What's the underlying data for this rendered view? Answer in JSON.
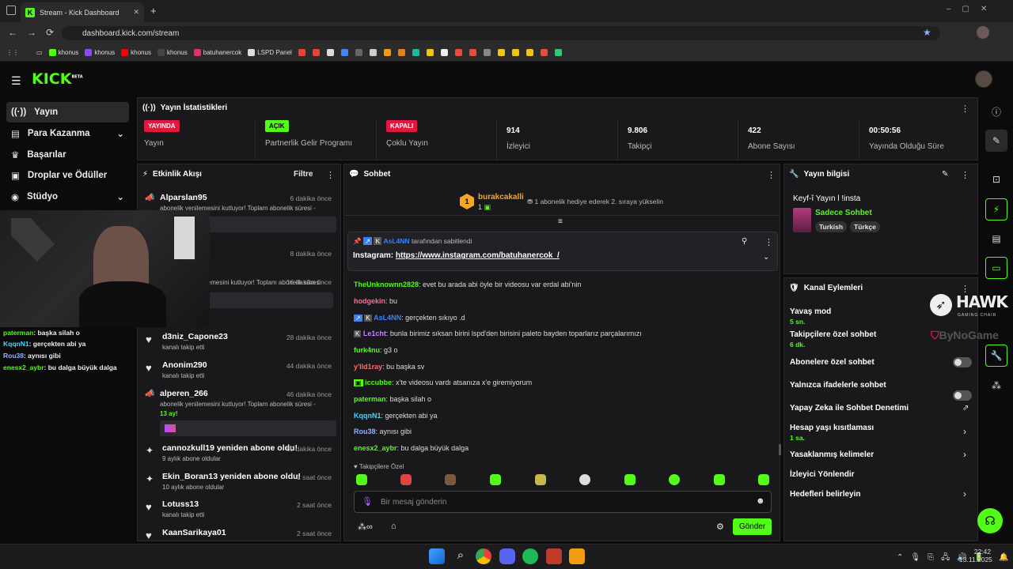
{
  "browser": {
    "tab_title": "Stream - Kick Dashboard",
    "url": "dashboard.kick.com/stream",
    "bookmarks": [
      "khonus",
      "khonus",
      "khonus",
      "khonus",
      "batuhanercok",
      "LSPD Panel"
    ]
  },
  "header": {
    "logo": "KICK",
    "beta": "BETA"
  },
  "sidebar": {
    "items": [
      {
        "label": "Yayın",
        "icon": "broadcast-icon"
      },
      {
        "label": "Para Kazanma",
        "icon": "money-icon"
      },
      {
        "label": "Başarılar",
        "icon": "trophy-icon"
      },
      {
        "label": "Droplar ve Ödüller",
        "icon": "gift-icon"
      },
      {
        "label": "Stüdyo",
        "icon": "studio-icon"
      }
    ]
  },
  "stats": {
    "title": "Yayın İstatistikleri",
    "cells": [
      {
        "badge": "YAYINDA",
        "label": "Yayın"
      },
      {
        "badge": "AÇIK",
        "label": "Partnerlik Gelir Programı"
      },
      {
        "badge": "KAPALI",
        "label": "Çoklu Yayın"
      },
      {
        "value": "914",
        "label": "İzleyici"
      },
      {
        "value": "9.806",
        "label": "Takipçi"
      },
      {
        "value": "422",
        "label": "Abone Sayısı"
      },
      {
        "value": "00:50:56",
        "label": "Yayında Olduğu Süre"
      }
    ]
  },
  "activity": {
    "title": "Etkinlik Akışı",
    "filter": "Filtre",
    "items": [
      {
        "name": "Alparslan95",
        "time": "6 dakika önce",
        "sub": "abonelik yenilemesini kutluyor! Toplam abonelik süresi -"
      },
      {
        "name": "z",
        "time": "8 dakika önce",
        "sub": ""
      },
      {
        "name": "",
        "time": "16 dakika önce",
        "sub": "lemesini kutluyor! Toplam abonelik süresi -"
      },
      {
        "name": "d3niz_Capone23",
        "time": "28 dakika önce",
        "sub": "kanalı takip etti"
      },
      {
        "name": "Anonim290",
        "time": "44 dakika önce",
        "sub": "kanalı takip etti"
      },
      {
        "name": "alperen_266",
        "time": "46 dakika önce",
        "sub": "abonelik yenilemesini kutluyor! Toplam abonelik süresi -",
        "sub2": "13 ay!"
      },
      {
        "name": "cannozkull19 yeniden abone oldu!",
        "time": "59 dakika önce",
        "sub": "9 aylık abone oldular"
      },
      {
        "name": "Ekin_Boran13 yeniden abone oldu!",
        "time": "1 saat önce",
        "sub": "10 aylık abone oldular"
      },
      {
        "name": "Lotuss13",
        "time": "2 saat önce",
        "sub": "kanalı takip etti"
      },
      {
        "name": "KaanSarikaya01",
        "time": "2 saat önce",
        "sub": ""
      }
    ]
  },
  "overlay_chat": [
    {
      "user": "paterman",
      "msg": ": başka silah o",
      "color": "#53fc18"
    },
    {
      "user": "KqqnN1",
      "msg": ": gerçekten abi ya",
      "color": "#4fd1ff"
    },
    {
      "user": "Rou38",
      "msg": ": aynısı gibi",
      "color": "#8fb3ff"
    },
    {
      "user": "enesx2_aybr",
      "msg": ": bu dalga büyük dalga",
      "color": "#53fc18"
    }
  ],
  "chat": {
    "title": "Sohbet",
    "top_user": "burakcakalli",
    "top_count": "1",
    "gift_text": "1 abonelik hediye ederek 2. sıraya yükselin",
    "pinned_by": "AsL4NN",
    "pinned_suffix": "tarafından sabitlendi",
    "pinned_prefix": "Instagram: ",
    "pinned_link": "https://www.instagram.com/batuhanercok_/",
    "messages": [
      {
        "user": "TheUnknownn2828",
        "msg": ": evet bu arada abi öyle bir videosu var erdal abi'nin",
        "color": "#53fc18"
      },
      {
        "user": "hodgekin",
        "msg": ": bu",
        "color": "#ff6b9d"
      },
      {
        "user": "AsL4NN",
        "msg": ": gerçekten sıkıyo .d",
        "color": "#3b82f6"
      },
      {
        "user": "Le1cht",
        "msg": ": bunla birimiz sıksan birini lspd'den birisini paleto bayden toparlarız parçalarımızı",
        "color": "#c084fc"
      },
      {
        "user": "furk4nu",
        "msg": ": g3 o",
        "color": "#53fc18"
      },
      {
        "user": "y'lld1ray",
        "msg": ": bu başka sv",
        "color": "#ff6b6b"
      },
      {
        "user": "iccubbe",
        "msg": ": x'te videosu vardı atsanıza x'e giremiyorum",
        "color": "#53fc18"
      },
      {
        "user": "paterman",
        "msg": ": başka silah o",
        "color": "#53fc18"
      },
      {
        "user": "KqqnN1",
        "msg": ": gerçekten abi ya",
        "color": "#4fd1ff"
      },
      {
        "user": "Rou38",
        "msg": ": aynısı gibi",
        "color": "#8fb3ff"
      },
      {
        "user": "enesx2_aybr",
        "msg": ": bu dalga büyük dalga",
        "color": "#53fc18"
      }
    ],
    "followers_only": "Takipçilere Özel",
    "placeholder": "Bir mesaj gönderin",
    "send": "Gönder"
  },
  "stream_info": {
    "title": "Yayın bilgisi",
    "stream_title": "Keyf-î Yayın l !insta",
    "category": "Sadece Sohbet",
    "tags": [
      "Turkish",
      "Türkçe"
    ]
  },
  "channel_actions": {
    "title": "Kanal Eylemleri",
    "items": [
      {
        "label": "Yavaş mod",
        "sub": "5 sn."
      },
      {
        "label": "Takipçilere özel sohbet",
        "sub": "6 dk."
      },
      {
        "label": "Abonelere özel sohbet",
        "sub": ""
      },
      {
        "label": "Yalnızca ifadelerle sohbet",
        "sub": ""
      },
      {
        "label": "Yapay Zeka ile Sohbet Denetimi",
        "sub": ""
      },
      {
        "label": "Hesap yaşı kısıtlaması",
        "sub": "1 sa."
      },
      {
        "label": "Yasaklanmış kelimeler",
        "sub": ""
      },
      {
        "label": "İzleyici Yönlendir",
        "sub": ""
      },
      {
        "label": "Hedefleri belirleyin",
        "sub": ""
      }
    ]
  },
  "sponsor": {
    "hawk": "HAWK",
    "hawk_sub": "GAMING CHAIR",
    "bynogame": "ByNoGame"
  },
  "taskbar": {
    "time": "22:42",
    "date": "13.11.2025"
  },
  "colors": {
    "accent": "#53fc18",
    "live": "#e3173e"
  }
}
